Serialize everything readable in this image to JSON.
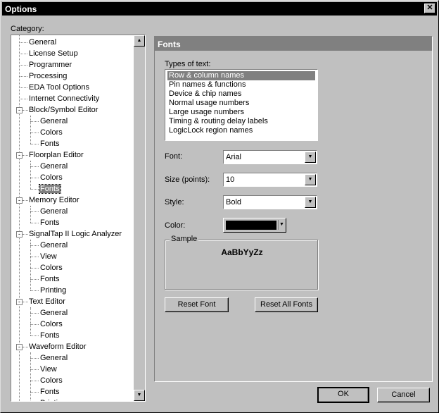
{
  "window": {
    "title": "Options"
  },
  "category_label": "Category:",
  "tree": [
    {
      "label": "General",
      "level": 0
    },
    {
      "label": "License Setup",
      "level": 0
    },
    {
      "label": "Programmer",
      "level": 0
    },
    {
      "label": "Processing",
      "level": 0
    },
    {
      "label": "EDA Tool Options",
      "level": 0
    },
    {
      "label": "Internet Connectivity",
      "level": 0
    },
    {
      "label": "Block/Symbol Editor",
      "level": 0,
      "expander": "-"
    },
    {
      "label": "General",
      "level": 1
    },
    {
      "label": "Colors",
      "level": 1
    },
    {
      "label": "Fonts",
      "level": 1
    },
    {
      "label": "Floorplan Editor",
      "level": 0,
      "expander": "-"
    },
    {
      "label": "General",
      "level": 1
    },
    {
      "label": "Colors",
      "level": 1
    },
    {
      "label": "Fonts",
      "level": 1,
      "selected": true
    },
    {
      "label": "Memory Editor",
      "level": 0,
      "expander": "-"
    },
    {
      "label": "General",
      "level": 1
    },
    {
      "label": "Fonts",
      "level": 1
    },
    {
      "label": "SignalTap II Logic Analyzer",
      "level": 0,
      "expander": "-"
    },
    {
      "label": "General",
      "level": 1
    },
    {
      "label": "View",
      "level": 1
    },
    {
      "label": "Colors",
      "level": 1
    },
    {
      "label": "Fonts",
      "level": 1
    },
    {
      "label": "Printing",
      "level": 1
    },
    {
      "label": "Text Editor",
      "level": 0,
      "expander": "-"
    },
    {
      "label": "General",
      "level": 1
    },
    {
      "label": "Colors",
      "level": 1
    },
    {
      "label": "Fonts",
      "level": 1
    },
    {
      "label": "Waveform Editor",
      "level": 0,
      "expander": "-"
    },
    {
      "label": "General",
      "level": 1
    },
    {
      "label": "View",
      "level": 1
    },
    {
      "label": "Colors",
      "level": 1
    },
    {
      "label": "Fonts",
      "level": 1
    },
    {
      "label": "Printing",
      "level": 1
    }
  ],
  "panel": {
    "title": "Fonts",
    "types_label": "Types of text:",
    "types": [
      "Row & column names",
      "Pin names & functions",
      "Device & chip names",
      "Normal usage numbers",
      "Large usage numbers",
      "Timing & routing delay labels",
      "LogicLock region names"
    ],
    "selected_type": 0,
    "font_label": "Font:",
    "font_value": "Arial",
    "size_label": "Size (points):",
    "size_value": "10",
    "style_label": "Style:",
    "style_value": "Bold",
    "color_label": "Color:",
    "color_value": "#000000",
    "sample_label": "Sample",
    "sample_text": "AaBbYyZz",
    "reset_font": "Reset Font",
    "reset_all_fonts": "Reset All Fonts"
  },
  "buttons": {
    "ok": "OK",
    "cancel": "Cancel"
  },
  "icons": {
    "close": "close-icon",
    "scroll_up": "arrow-up-icon",
    "scroll_down": "arrow-down-icon",
    "dropdown": "chevron-down-icon"
  }
}
